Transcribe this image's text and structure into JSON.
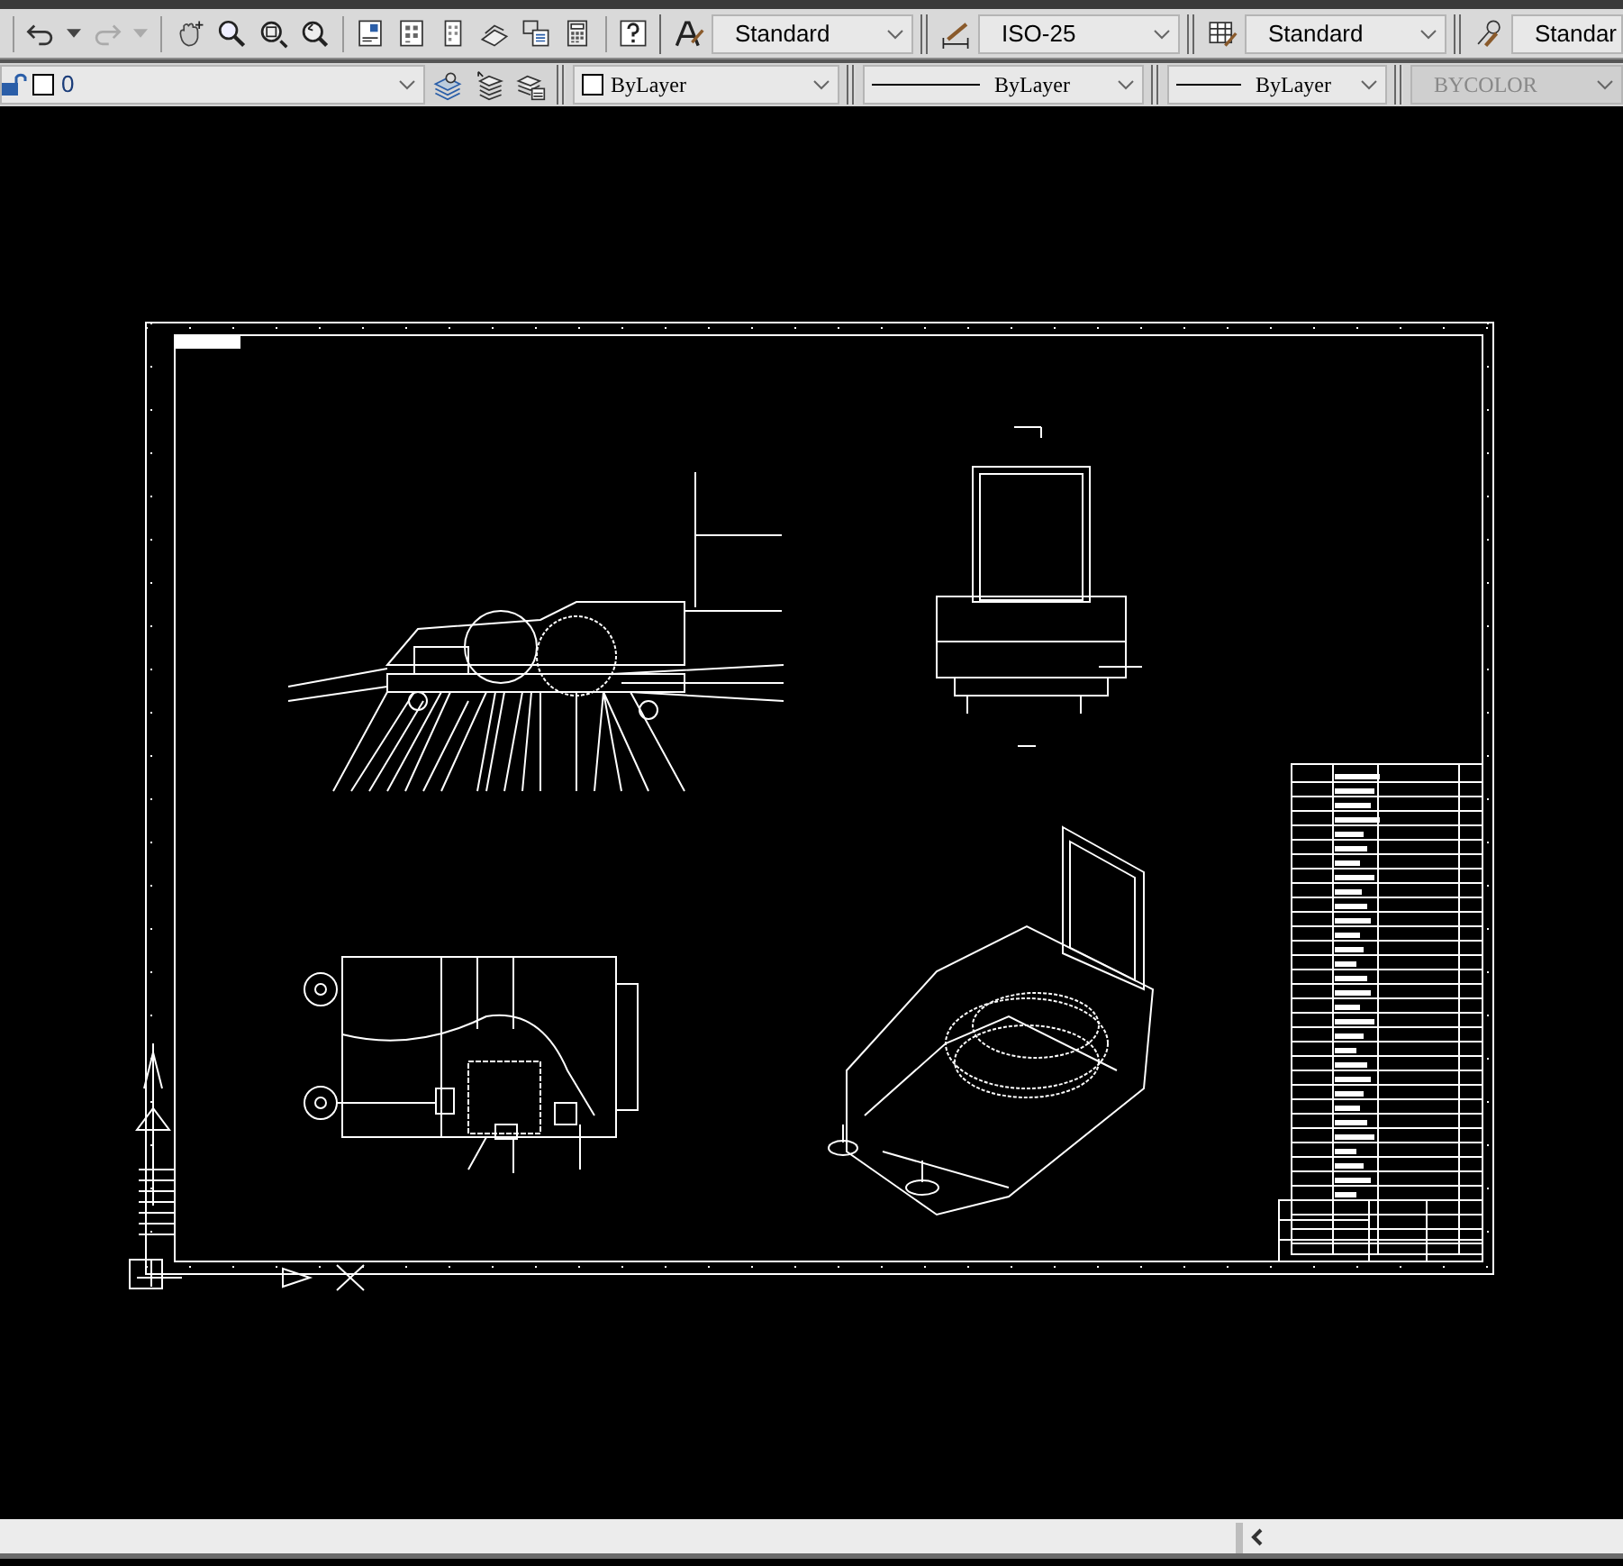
{
  "styles_toolbar": [
    {
      "kind": "text_style",
      "value": "Standard"
    },
    {
      "kind": "dimension_style",
      "value": "ISO-25"
    },
    {
      "kind": "table_style",
      "value": "Standard"
    },
    {
      "kind": "multileader_style",
      "value": "Standar"
    }
  ],
  "layer": {
    "name": "0",
    "locked": false
  },
  "properties_toolbar": [
    {
      "kind": "color",
      "value": "ByLayer",
      "disabled": false
    },
    {
      "kind": "linetype",
      "value": "ByLayer",
      "disabled": false
    },
    {
      "kind": "lineweight",
      "value": "ByLayer",
      "disabled": false
    },
    {
      "kind": "plot_style",
      "value": "BYCOLOR",
      "disabled": true
    }
  ]
}
